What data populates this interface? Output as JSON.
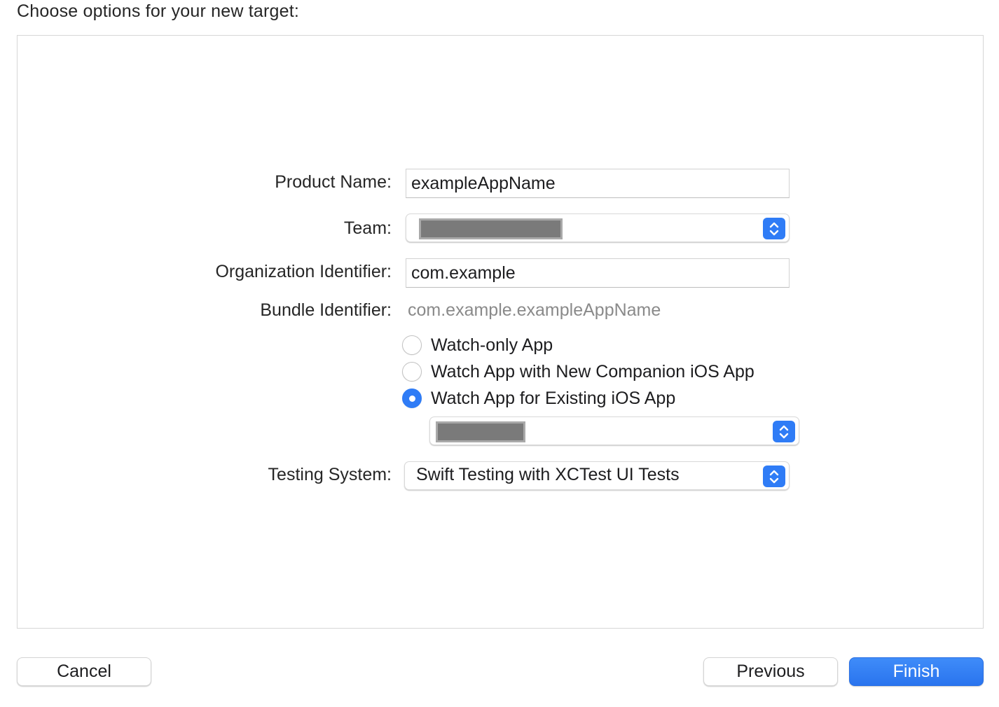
{
  "header": {
    "title": "Choose options for your new target:"
  },
  "form": {
    "product_name": {
      "label": "Product Name:",
      "value": "exampleAppName"
    },
    "team": {
      "label": "Team:",
      "value": ""
    },
    "organization_identifier": {
      "label": "Organization Identifier:",
      "value": "com.example"
    },
    "bundle_identifier": {
      "label": "Bundle Identifier:",
      "value": "com.example.exampleAppName"
    },
    "app_type": {
      "options": [
        {
          "label": "Watch-only App",
          "selected": false
        },
        {
          "label": "Watch App with New Companion iOS App",
          "selected": false
        },
        {
          "label": "Watch App for Existing iOS App",
          "selected": true
        }
      ],
      "existing_app_value": ""
    },
    "testing_system": {
      "label": "Testing System:",
      "value": "Swift Testing with XCTest UI Tests"
    }
  },
  "footer": {
    "cancel_label": "Cancel",
    "previous_label": "Previous",
    "finish_label": "Finish"
  },
  "colors": {
    "accent": "#2f7cf6",
    "redacted": "#7a7a7a"
  },
  "icons": {
    "popup_stepper": "chevron-up-down-icon"
  }
}
